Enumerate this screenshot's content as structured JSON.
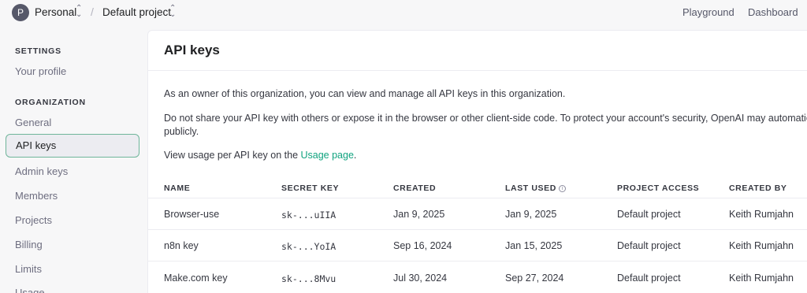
{
  "topbar": {
    "avatar_initial": "P",
    "org_name": "Personal",
    "switch_glyph": "⌃⌄",
    "separator": "/",
    "project_name": "Default project",
    "links": [
      "Playground",
      "Dashboard"
    ]
  },
  "sidebar": {
    "settings_title": "SETTINGS",
    "settings_items": [
      "Your profile"
    ],
    "org_title": "ORGANIZATION",
    "org_items": [
      "General",
      "API keys",
      "Admin keys",
      "Members",
      "Projects",
      "Billing",
      "Limits",
      "Usage"
    ],
    "active_item": "API keys"
  },
  "main": {
    "title": "API keys",
    "para1": "As an owner of this organization, you can view and manage all API keys in this organization.",
    "para2_line1": "Do not share your API key with others or expose it in the browser or other client-side code. To protect your account's security, OpenAI may automatically di",
    "para2_line2": "publicly.",
    "para3_prefix": "View usage per API key on the ",
    "para3_link": "Usage page",
    "para3_suffix": "."
  },
  "table": {
    "columns": [
      "NAME",
      "SECRET KEY",
      "CREATED",
      "LAST USED",
      "PROJECT ACCESS",
      "CREATED BY"
    ],
    "info_glyph": "i",
    "rows": [
      {
        "name": "Browser-use",
        "secret": "sk-...uIIA",
        "created": "Jan 9, 2025",
        "last_used": "Jan 9, 2025",
        "project": "Default project",
        "created_by": "Keith Rumjahn"
      },
      {
        "name": "n8n key",
        "secret": "sk-...YoIA",
        "created": "Sep 16, 2024",
        "last_used": "Jan 15, 2025",
        "project": "Default project",
        "created_by": "Keith Rumjahn"
      },
      {
        "name": "Make.com key",
        "secret": "sk-...8Mvu",
        "created": "Jul 30, 2024",
        "last_used": "Sep 27, 2024",
        "project": "Default project",
        "created_by": "Keith Rumjahn"
      }
    ]
  },
  "colors": {
    "accent": "#10a37f",
    "active_border": "#6fb59a",
    "sidebar_bg": "#f7f7f8",
    "avatar_bg": "#565869"
  }
}
